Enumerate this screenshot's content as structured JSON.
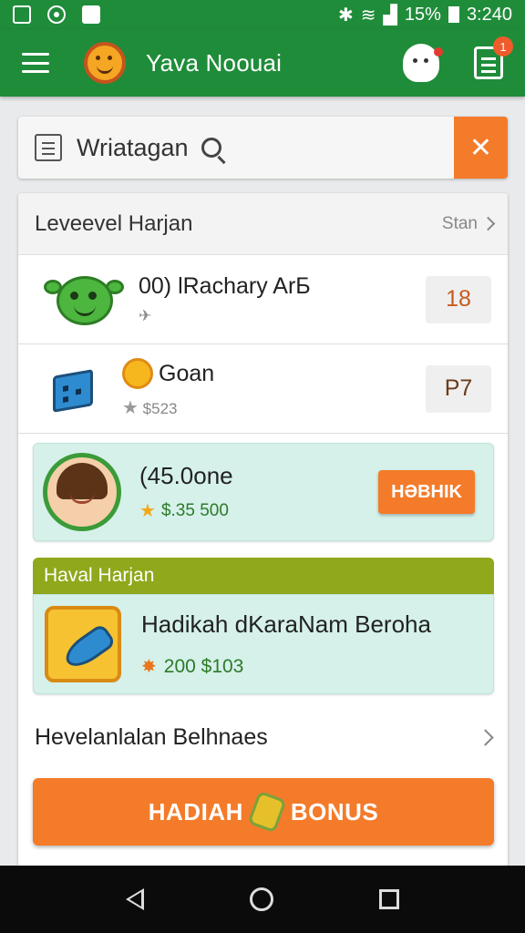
{
  "status_bar": {
    "battery": "15%",
    "time": "3:240"
  },
  "app_bar": {
    "title": "Yava Noouai",
    "notification_count": "1"
  },
  "search": {
    "value": "Wriatagan"
  },
  "leaderboard": {
    "title": "Leveevel Harjan",
    "see_all": "Stan",
    "rows": [
      {
        "name": "00) lRachary ArБ",
        "sub": "✈",
        "score": "18"
      },
      {
        "name": "Goan",
        "sub": "$523",
        "score": "P7"
      }
    ],
    "highlight": {
      "name": "(45.0one",
      "sub": "$.35 500",
      "button": "HƏBHIK"
    }
  },
  "reward_section": {
    "title": "Haval Harjan",
    "item_name": "Hadikah dKaraNam Beroha",
    "item_sub": "200  $103"
  },
  "link_row": {
    "label": "Hevelanlalan Belhnaes"
  },
  "bonus_button": {
    "left": "HADIAH",
    "right": "BONUS"
  },
  "colors": {
    "primary": "#1f8c3a",
    "accent": "#f47b29",
    "promo_bg": "#d5f1ea",
    "section_bar": "#8fa81c"
  }
}
